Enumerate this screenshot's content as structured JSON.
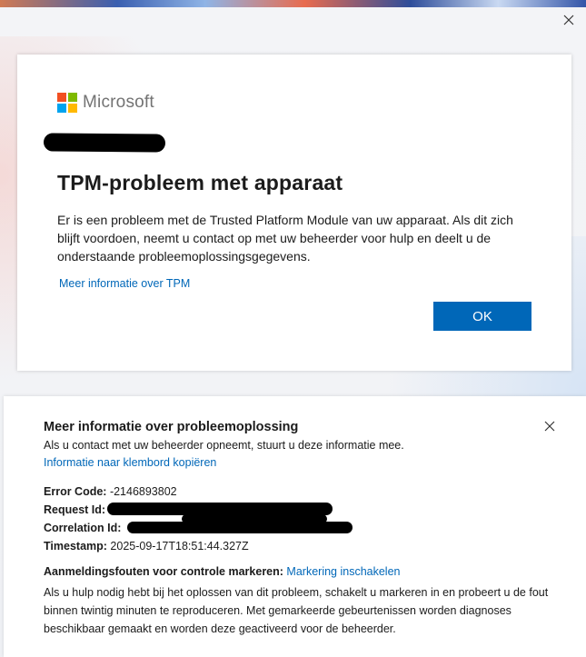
{
  "window": {
    "close_icon": "close-icon"
  },
  "brand": {
    "name": "Microsoft",
    "colors": [
      "#f25022",
      "#7fba00",
      "#00a4ef",
      "#ffb900"
    ]
  },
  "dialog": {
    "title": "TPM-probleem met apparaat",
    "body": "Er is een probleem met de Trusted Platform Module van uw apparaat. Als dit zich blijft voordoen, neemt u contact op met uw beheerder voor hulp en deelt u de onderstaande probleemoplossingsgegevens.",
    "more_info_link": "Meer informatie over TPM",
    "ok_label": "OK",
    "accent": "#0067b8"
  },
  "troubleshooting": {
    "title": "Meer informatie over probleemoplossing",
    "subtitle": "Als u contact met uw beheerder opneemt, stuurt u deze informatie mee.",
    "copy_link": "Informatie naar klembord kopiëren",
    "error_code_label": "Error Code:",
    "error_code_value": "-2146893802",
    "request_id_label": "Request Id:",
    "correlation_id_label": "Correlation Id:",
    "timestamp_label": "Timestamp:",
    "timestamp_value": "2025-09-17T18:51:44.327Z",
    "marker_label": "Aanmeldingsfouten voor controle markeren:",
    "marker_link": "Markering inschakelen",
    "marker_description": "Als u hulp nodig hebt bij het oplossen van dit probleem, schakelt u markeren in en probeert u de fout binnen twintig minuten te reproduceren. Met gemarkeerde gebeurtenissen worden diagnoses beschikbaar gemaakt en worden deze geactiveerd voor de beheerder."
  }
}
